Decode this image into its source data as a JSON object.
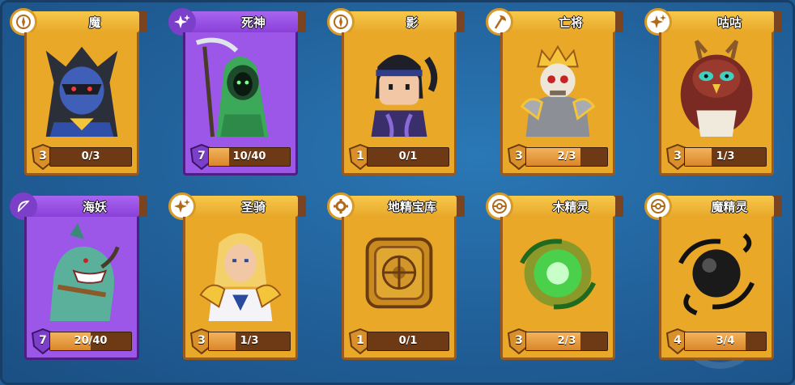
{
  "colors": {
    "gold_card": "#e9a827",
    "epic_card": "#9c56e8",
    "background": "#215f98"
  },
  "cards": [
    {
      "name": "魔",
      "level": "3",
      "progress": "0/3",
      "fraction": 0.0,
      "rarity": "gold",
      "badge_icon": "compass-icon",
      "portrait": "dark-knight-portrait"
    },
    {
      "name": "死神",
      "level": "7",
      "progress": "10/40",
      "fraction": 0.25,
      "rarity": "epic",
      "badge_icon": "sparkle-icon",
      "portrait": "reaper-portrait"
    },
    {
      "name": "影",
      "level": "1",
      "progress": "0/1",
      "fraction": 0.0,
      "rarity": "gold",
      "badge_icon": "compass-icon",
      "portrait": "ninja-portrait"
    },
    {
      "name": "亡将",
      "level": "3",
      "progress": "2/3",
      "fraction": 0.667,
      "rarity": "gold",
      "badge_icon": "axe-icon",
      "portrait": "skeleton-king-portrait"
    },
    {
      "name": "咕咕",
      "level": "3",
      "progress": "1/3",
      "fraction": 0.333,
      "rarity": "gold",
      "badge_icon": "sparkle-icon",
      "portrait": "owl-portrait"
    },
    {
      "name": "海妖",
      "level": "7",
      "progress": "20/40",
      "fraction": 0.5,
      "rarity": "epic",
      "badge_icon": "bow-icon",
      "portrait": "shark-portrait"
    },
    {
      "name": "圣骑",
      "level": "3",
      "progress": "1/3",
      "fraction": 0.333,
      "rarity": "gold",
      "badge_icon": "sparkle-icon",
      "portrait": "paladin-portrait"
    },
    {
      "name": "地精宝库",
      "level": "1",
      "progress": "0/1",
      "fraction": 0.0,
      "rarity": "gold",
      "badge_icon": "gear-icon",
      "portrait": "vault-portrait"
    },
    {
      "name": "木精灵",
      "level": "3",
      "progress": "2/3",
      "fraction": 0.667,
      "rarity": "gold",
      "badge_icon": "orb-icon",
      "portrait": "green-orb-portrait"
    },
    {
      "name": "魔精灵",
      "level": "4",
      "progress": "3/4",
      "fraction": 0.75,
      "rarity": "gold",
      "badge_icon": "orb-icon",
      "portrait": "dark-orb-portrait"
    }
  ]
}
